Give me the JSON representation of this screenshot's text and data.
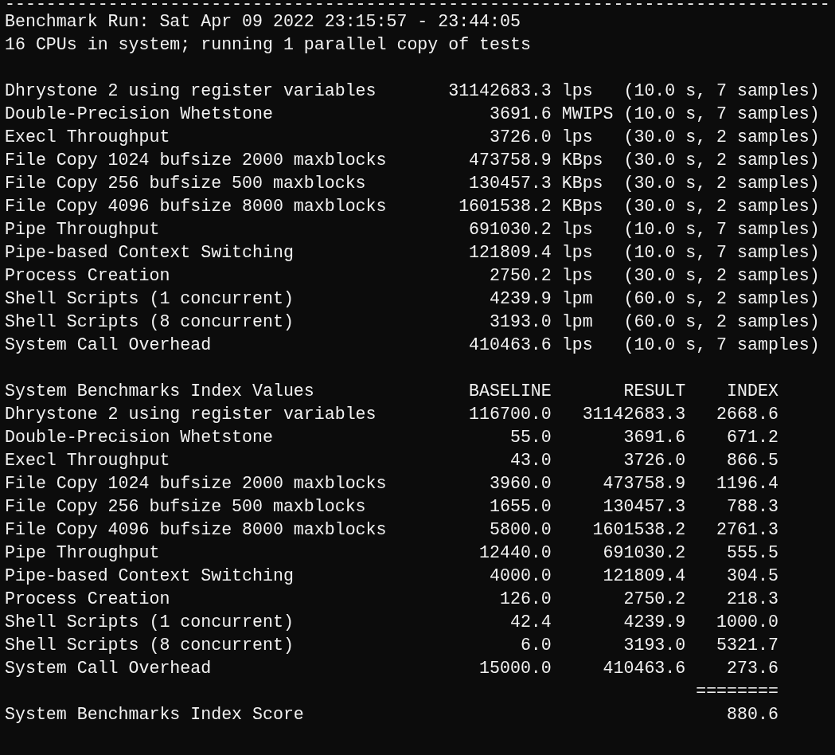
{
  "top_rule": "--------------------------------------------------------------------------------",
  "header": [
    "Benchmark Run: Sat Apr 09 2022 23:15:57 - 23:44:05",
    "16 CPUs in system; running 1 parallel copy of tests"
  ],
  "results": [
    {
      "test": "Dhrystone 2 using register variables",
      "value": "31142683.3",
      "unit": "lps",
      "timing": "(10.0 s, 7 samples)"
    },
    {
      "test": "Double-Precision Whetstone",
      "value": "3691.6",
      "unit": "MWIPS",
      "timing": "(10.0 s, 7 samples)"
    },
    {
      "test": "Execl Throughput",
      "value": "3726.0",
      "unit": "lps",
      "timing": "(30.0 s, 2 samples)"
    },
    {
      "test": "File Copy 1024 bufsize 2000 maxblocks",
      "value": "473758.9",
      "unit": "KBps",
      "timing": "(30.0 s, 2 samples)"
    },
    {
      "test": "File Copy 256 bufsize 500 maxblocks",
      "value": "130457.3",
      "unit": "KBps",
      "timing": "(30.0 s, 2 samples)"
    },
    {
      "test": "File Copy 4096 bufsize 8000 maxblocks",
      "value": "1601538.2",
      "unit": "KBps",
      "timing": "(30.0 s, 2 samples)"
    },
    {
      "test": "Pipe Throughput",
      "value": "691030.2",
      "unit": "lps",
      "timing": "(10.0 s, 7 samples)"
    },
    {
      "test": "Pipe-based Context Switching",
      "value": "121809.4",
      "unit": "lps",
      "timing": "(10.0 s, 7 samples)"
    },
    {
      "test": "Process Creation",
      "value": "2750.2",
      "unit": "lps",
      "timing": "(30.0 s, 2 samples)"
    },
    {
      "test": "Shell Scripts (1 concurrent)",
      "value": "4239.9",
      "unit": "lpm",
      "timing": "(60.0 s, 2 samples)"
    },
    {
      "test": "Shell Scripts (8 concurrent)",
      "value": "3193.0",
      "unit": "lpm",
      "timing": "(60.0 s, 2 samples)"
    },
    {
      "test": "System Call Overhead",
      "value": "410463.6",
      "unit": "lps",
      "timing": "(10.0 s, 7 samples)"
    }
  ],
  "index_table": {
    "columns": [
      "System Benchmarks Index Values",
      "BASELINE",
      "RESULT",
      "INDEX"
    ],
    "rows": [
      {
        "test": "Dhrystone 2 using register variables",
        "baseline": "116700.0",
        "result": "31142683.3",
        "index": "2668.6"
      },
      {
        "test": "Double-Precision Whetstone",
        "baseline": "55.0",
        "result": "3691.6",
        "index": "671.2"
      },
      {
        "test": "Execl Throughput",
        "baseline": "43.0",
        "result": "3726.0",
        "index": "866.5"
      },
      {
        "test": "File Copy 1024 bufsize 2000 maxblocks",
        "baseline": "3960.0",
        "result": "473758.9",
        "index": "1196.4"
      },
      {
        "test": "File Copy 256 bufsize 500 maxblocks",
        "baseline": "1655.0",
        "result": "130457.3",
        "index": "788.3"
      },
      {
        "test": "File Copy 4096 bufsize 8000 maxblocks",
        "baseline": "5800.0",
        "result": "1601538.2",
        "index": "2761.3"
      },
      {
        "test": "Pipe Throughput",
        "baseline": "12440.0",
        "result": "691030.2",
        "index": "555.5"
      },
      {
        "test": "Pipe-based Context Switching",
        "baseline": "4000.0",
        "result": "121809.4",
        "index": "304.5"
      },
      {
        "test": "Process Creation",
        "baseline": "126.0",
        "result": "2750.2",
        "index": "218.3"
      },
      {
        "test": "Shell Scripts (1 concurrent)",
        "baseline": "42.4",
        "result": "4239.9",
        "index": "1000.0"
      },
      {
        "test": "Shell Scripts (8 concurrent)",
        "baseline": "6.0",
        "result": "3193.0",
        "index": "5321.7"
      },
      {
        "test": "System Call Overhead",
        "baseline": "15000.0",
        "result": "410463.6",
        "index": "273.6"
      }
    ],
    "separator": "========",
    "score": {
      "label": "System Benchmarks Index Score",
      "value": "880.6"
    }
  }
}
